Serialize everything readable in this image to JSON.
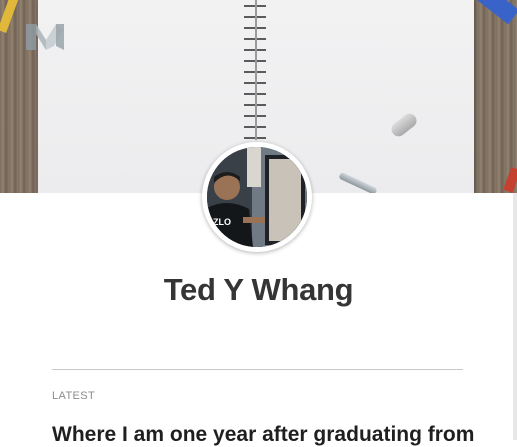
{
  "profile": {
    "name": "Ted Y Whang"
  },
  "section": {
    "label": "LATEST"
  },
  "posts": [
    {
      "title": "Where I am one year after graduating from"
    }
  ],
  "header": {
    "logo_icon": "medium-logo-icon",
    "avatar_shirt_text": "ZLO"
  },
  "colors": {
    "name_text": "#353535",
    "section_label": "#8c8c8c",
    "post_title": "#1f1f1f",
    "rule": "#c8c8c8"
  }
}
